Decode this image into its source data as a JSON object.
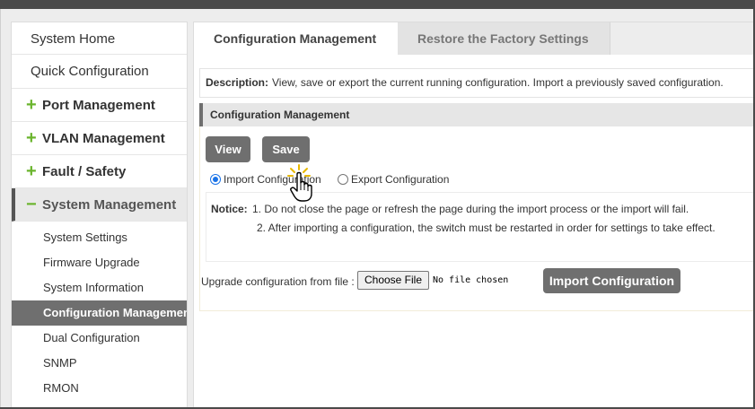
{
  "sidebar": {
    "top_items": [
      {
        "label": "System Home"
      },
      {
        "label": "Quick Configuration"
      }
    ],
    "groups": [
      {
        "label": "Port Management",
        "symbol": "+"
      },
      {
        "label": "VLAN Management",
        "symbol": "+"
      },
      {
        "label": "Fault / Safety",
        "symbol": "+"
      },
      {
        "label": "System Management",
        "symbol": "−"
      }
    ],
    "sub_items": [
      {
        "label": "System Settings"
      },
      {
        "label": "Firmware Upgrade"
      },
      {
        "label": "System Information"
      },
      {
        "label": "Configuration Management",
        "active": true
      },
      {
        "label": "Dual Configuration"
      },
      {
        "label": "SNMP"
      },
      {
        "label": "RMON"
      }
    ]
  },
  "tabs": [
    {
      "label": "Configuration Management",
      "active": true
    },
    {
      "label": "Restore the Factory Settings",
      "active": false
    }
  ],
  "description": {
    "label": "Description:",
    "text": "View, save or export the current running configuration. Import a previously saved configuration."
  },
  "section": {
    "title": "Configuration Management",
    "view_label": "View",
    "save_label": "Save",
    "radio_import": "Import Configuration",
    "radio_export": "Export Configuration",
    "selected_radio": "import",
    "notice_label": "Notice:",
    "notice_1": "1. Do not close the page or refresh the page during the import process or the import will fail.",
    "notice_2": "2. After importing a configuration, the switch must be restarted in order for settings to take effect.",
    "upload_label": "Upgrade configuration from file :",
    "choose_file_label": "Choose File",
    "file_status": "No file chosen",
    "import_button_label": "Import Configuration"
  },
  "colors": {
    "accent_button": "#6f6f6f",
    "plus_icon": "#6ab42d",
    "active_sidebar": "#6f6f6f"
  },
  "icons": {
    "cursor": "hand-pointer-icon"
  }
}
